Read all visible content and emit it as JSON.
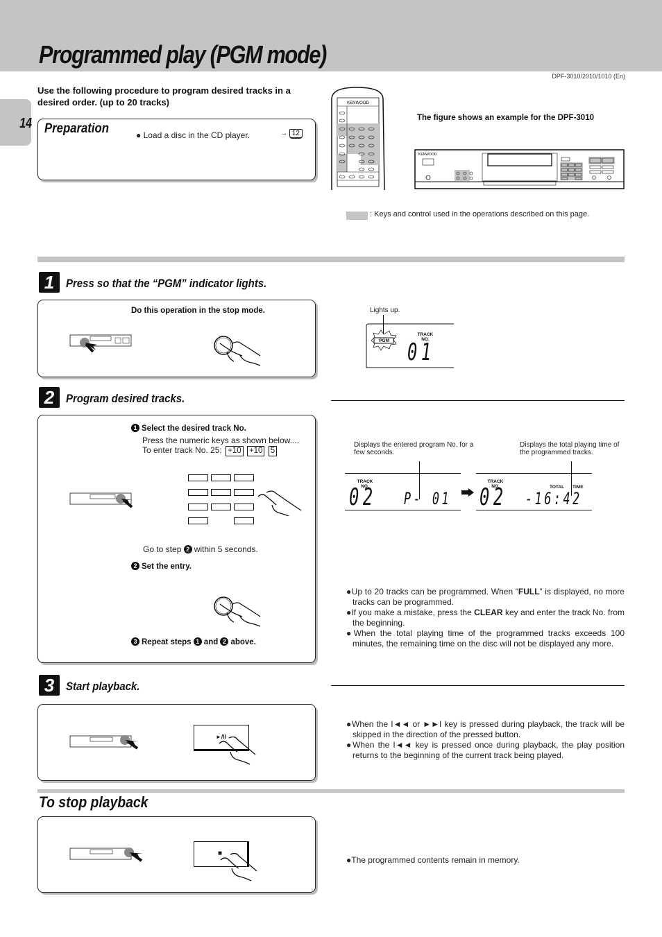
{
  "header": {
    "title": "Programmed play (PGM mode)",
    "model_ref": "DPF-3010/2010/1010 (En)",
    "page_number": "14"
  },
  "intro": "Use the following procedure to program desired tracks in a desired order. (up to 20 tracks)",
  "preparation": {
    "title": "Preparation",
    "bullet": "● Load a disc in the CD player.",
    "ref_arrow": "→",
    "ref_page": "12"
  },
  "figure": {
    "caption": "The figure shows an example for the DPF-3010",
    "remote_brand": "KENWOOD",
    "player_brand": "KENWOOD",
    "legend_text": ": Keys and control used in the operations described on this page.",
    "highlight_color": "#c4c4c4"
  },
  "step1": {
    "number": "1",
    "title": "Press so that the “PGM” indicator lights.",
    "instruction": "Do this operation in the stop mode.",
    "display": {
      "callout": "Lights up.",
      "indicator": "PGM",
      "track_label_1": "TRACK",
      "track_label_2": "NO.",
      "digits": "01"
    }
  },
  "step2": {
    "number": "2",
    "title": "Program desired tracks.",
    "sub1_marker": "1",
    "sub1_title": "Select the desired track No.",
    "sub1_line1": "Press the numeric keys as shown below....",
    "sub1_line2": "To enter track No. 25:",
    "sub1_keys": [
      "+10",
      "+10",
      "5"
    ],
    "goto_pre": "Go to step",
    "goto_marker": "2",
    "goto_post": "within 5 seconds.",
    "sub2_marker": "2",
    "sub2_title": "Set the entry.",
    "sub3_marker": "3",
    "sub3_pre": "Repeat steps",
    "sub3_m1": "1",
    "sub3_and": "and",
    "sub3_m2": "2",
    "sub3_post": "above.",
    "display_left": {
      "callout": "Displays the entered program No. for a few seconds.",
      "track_label_1": "TRACK",
      "track_label_2": "NO.",
      "digits": "02",
      "program": "P- 01"
    },
    "display_right": {
      "callout": "Displays the total playing time of the programmed tracks.",
      "track_label_1": "TRACK",
      "track_label_2": "NO.",
      "total_label": "TOTAL",
      "time_label": "TIME",
      "digits": "02",
      "time": "-16:42"
    },
    "notes": [
      {
        "pre": "●Up to 20 tracks can be programmed.  When “",
        "bold": "FULL",
        "post": "” is displayed, no more tracks can be programmed."
      },
      {
        "pre": "●If you make a mistake, press the ",
        "bold": "CLEAR",
        "post": " key and enter  the track No. from the beginning."
      },
      {
        "pre": "●When the total playing time of the programmed tracks exceeds 100 minutes, the remaining time on the disc will not be displayed any more.",
        "bold": "",
        "post": ""
      }
    ]
  },
  "step3": {
    "number": "3",
    "title": "Start playback.",
    "button_label": "►/II",
    "notes": [
      "●When the I◄◄ or ►►I key is pressed during playback,  the track will be skipped in the direction of the  pressed button.",
      "●When the I◄◄ key is pressed once during playback, the  play position returns to the beginning of the current  track being played."
    ]
  },
  "stop": {
    "title": "To stop playback",
    "button_label": "■",
    "note": "●The programmed contents remain in memory."
  }
}
